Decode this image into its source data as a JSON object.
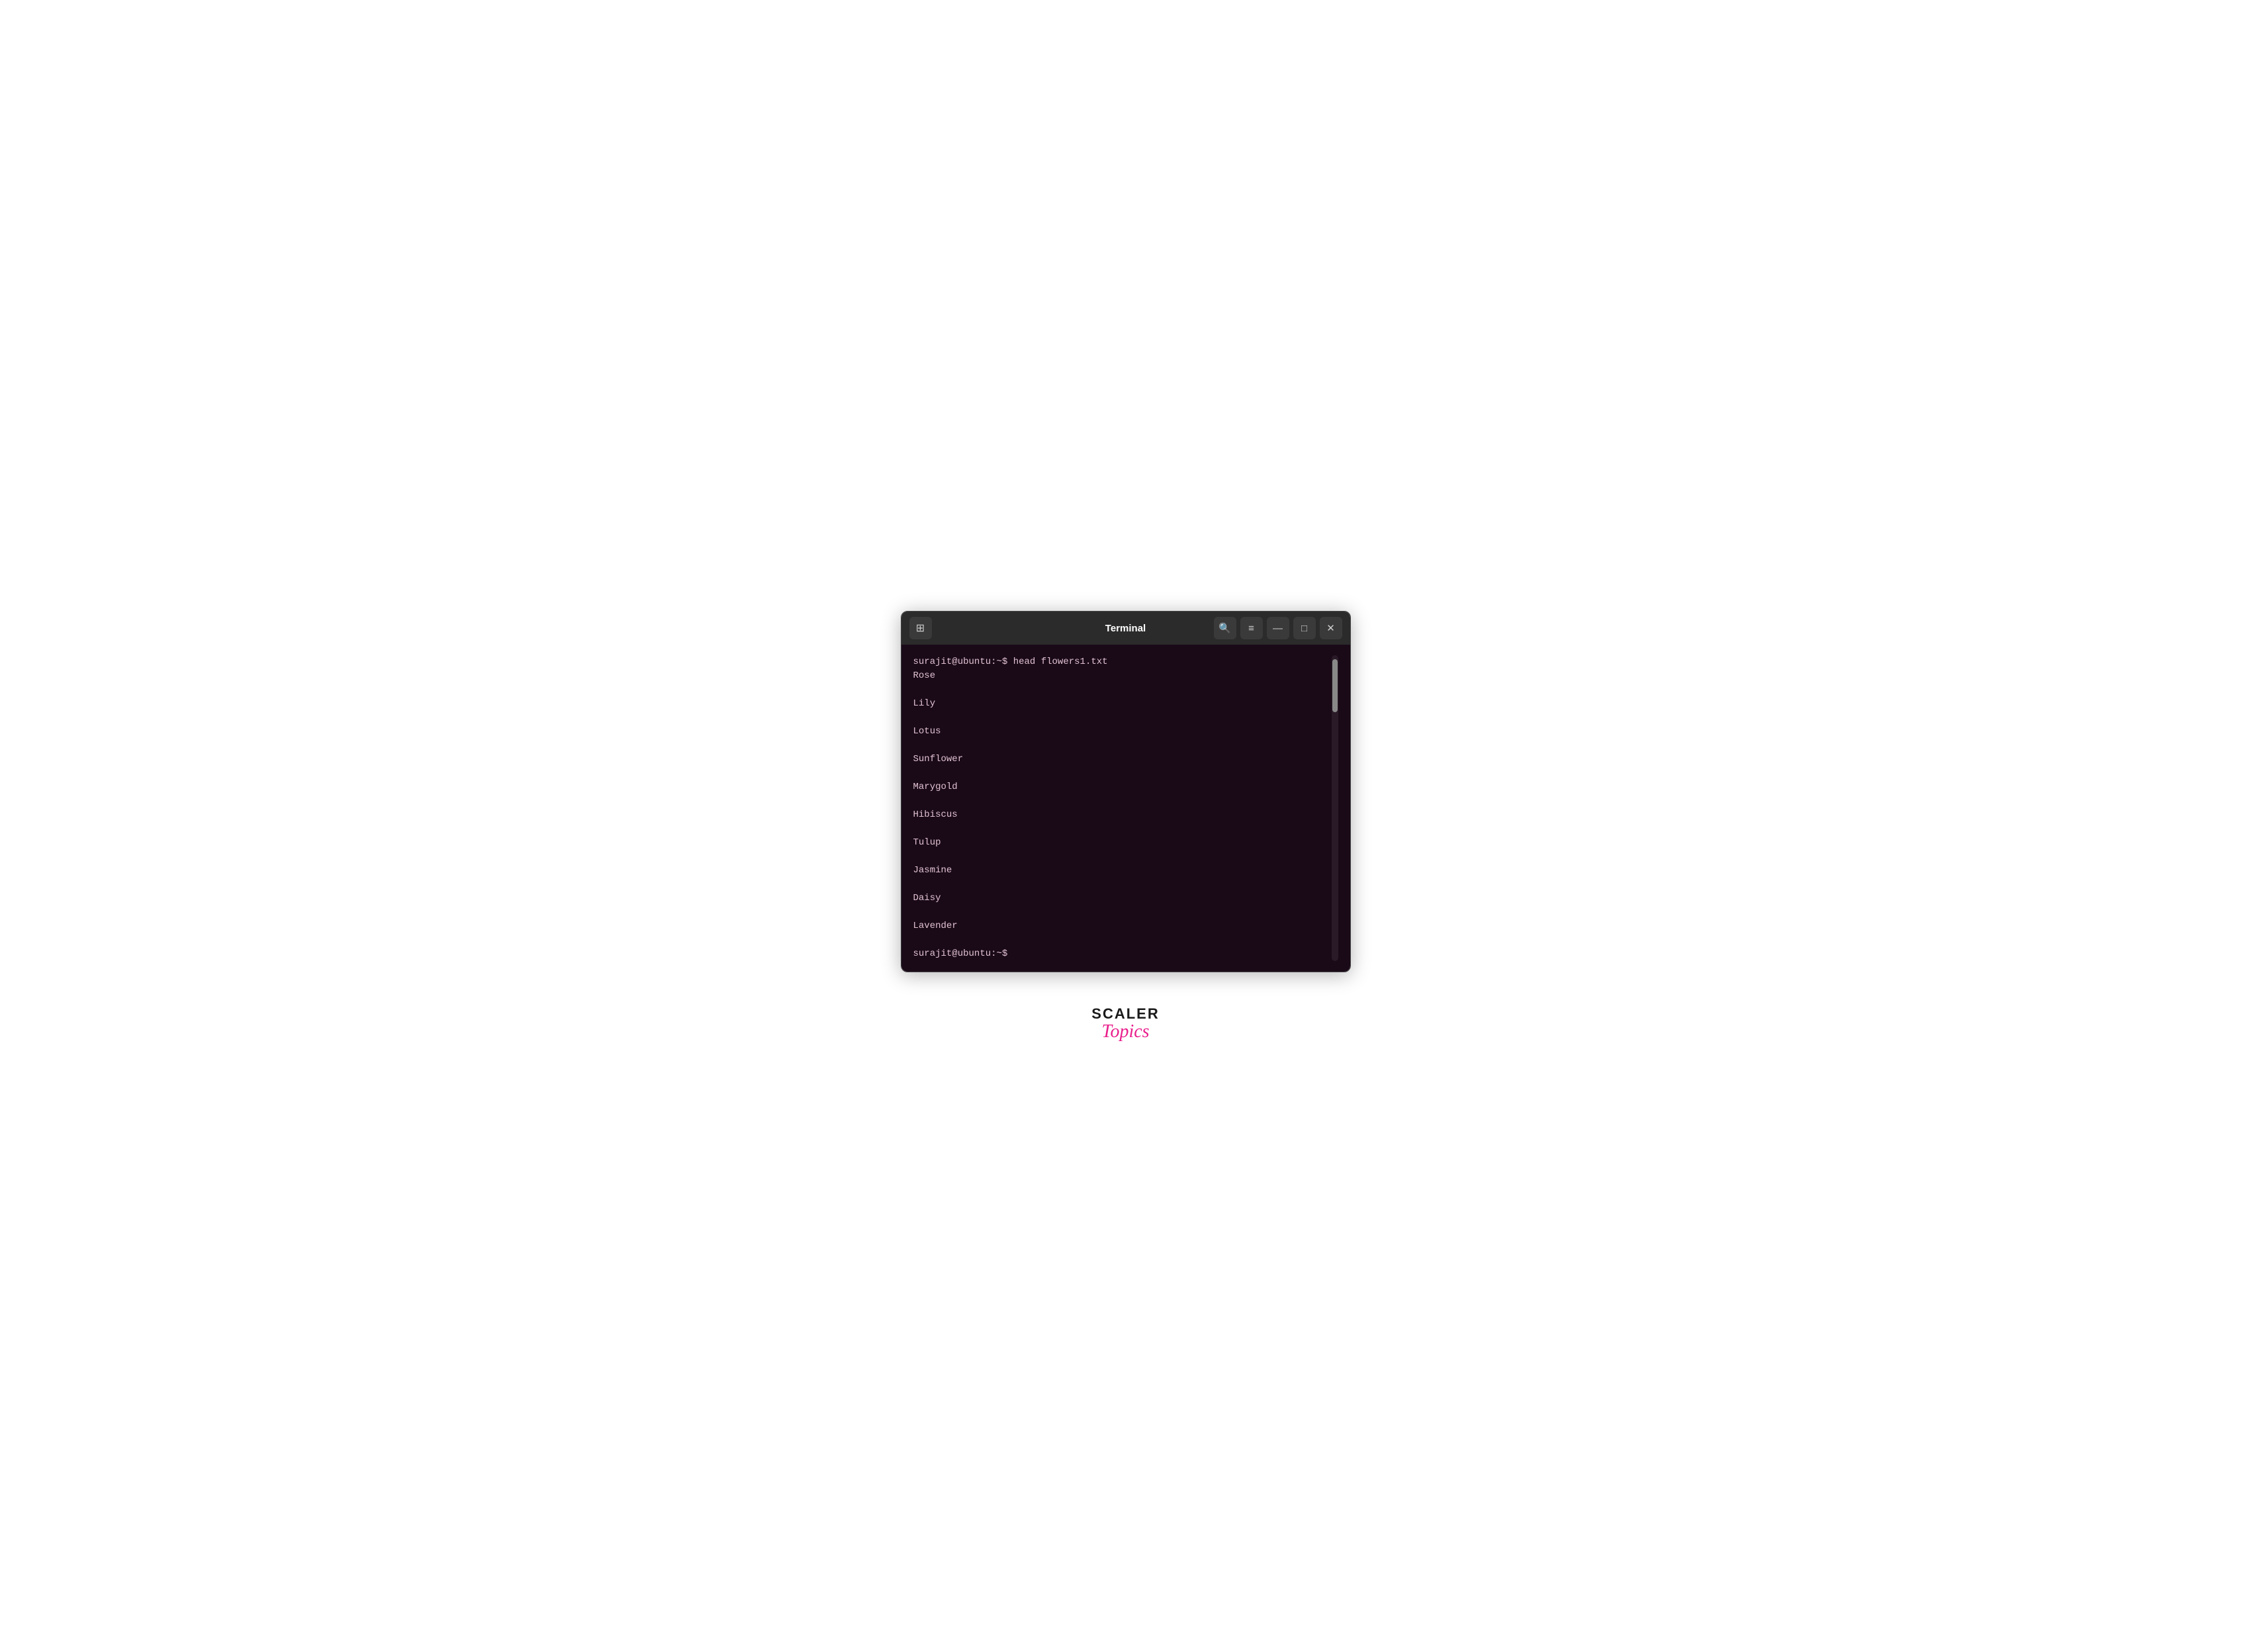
{
  "window": {
    "title": "Terminal",
    "new_tab_icon": "⊞",
    "search_icon": "🔍",
    "menu_icon": "≡",
    "minimize_icon": "—",
    "maximize_icon": "□",
    "close_icon": "✕"
  },
  "terminal": {
    "prompt1": "surajit@ubuntu:~$ head flowers1.txt",
    "output": [
      "Rose",
      "Lily",
      "Lotus",
      "Sunflower",
      "Marygold",
      "Hibiscus",
      "Tulup",
      "Jasmine",
      "Daisy",
      "Lavender"
    ],
    "prompt2": "surajit@ubuntu:~$"
  },
  "logo": {
    "scaler": "SCALER",
    "topics": "Topics"
  }
}
